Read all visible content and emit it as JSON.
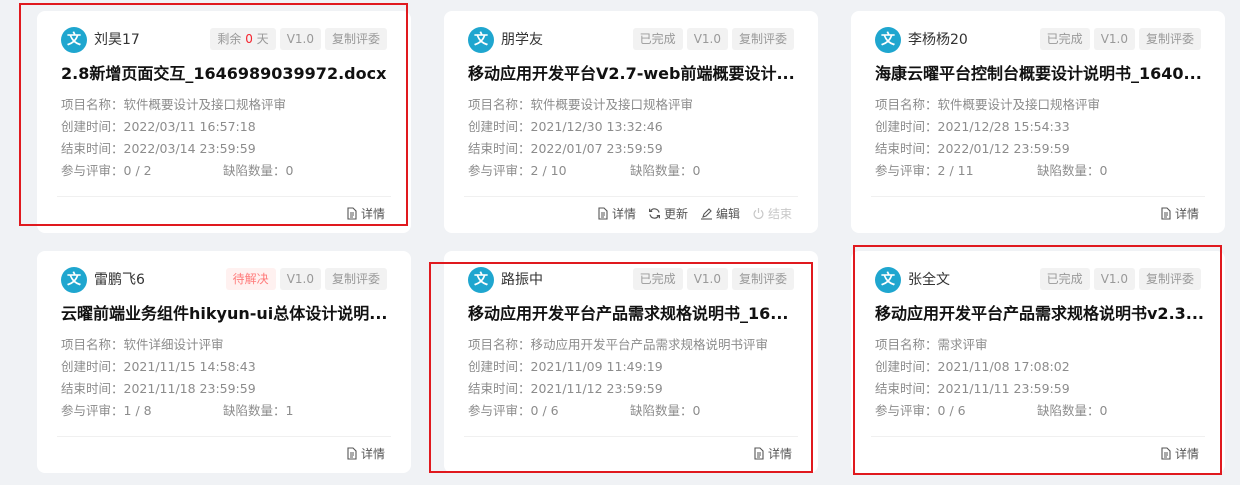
{
  "labels": {
    "project": "项目名称：",
    "created": "创建时间：",
    "ended": "结束时间：",
    "participants": "参与评审：",
    "defects": "缺陷数量：",
    "detail": "详情",
    "update": "更新",
    "edit": "编辑",
    "finish": "结束",
    "version": "V1.0",
    "copy_reviewers": "复制评委",
    "remaining_prefix": "剩余",
    "remaining_suffix": "天"
  },
  "cards": [
    {
      "avatar": "文",
      "user": "刘昊17",
      "status": "",
      "remaining_days": "0",
      "title": "2.8新增页面交互_1646989039972.docx",
      "project": "软件概要设计及接口规格评审",
      "created": "2022/03/11 16:57:18",
      "ended": "2022/03/14 23:59:59",
      "participants": "0 / 2",
      "defects": "0"
    },
    {
      "avatar": "文",
      "user": "朋学友",
      "status": "已完成",
      "title": "移动应用开发平台V2.7-web前端概要设计...",
      "project": "软件概要设计及接口规格评审",
      "created": "2021/12/30 13:32:46",
      "ended": "2022/01/07 23:59:59",
      "participants": "2 / 10",
      "defects": "0"
    },
    {
      "avatar": "文",
      "user": "李杨杨20",
      "status": "已完成",
      "title": "海康云曜平台控制台概要设计说明书_1640...",
      "project": "软件概要设计及接口规格评审",
      "created": "2021/12/28 15:54:33",
      "ended": "2022/01/12 23:59:59",
      "participants": "2 / 11",
      "defects": "0"
    },
    {
      "avatar": "文",
      "user": "雷鹏飞6",
      "status": "待解决",
      "title": "云曜前端业务组件hikyun-ui总体设计说明...",
      "project": "软件详细设计评审",
      "created": "2021/11/15 14:58:43",
      "ended": "2021/11/18 23:59:59",
      "participants": "1 / 8",
      "defects": "1"
    },
    {
      "avatar": "文",
      "user": "路振中",
      "status": "已完成",
      "title": "移动应用开发平台产品需求规格说明书_16...",
      "project": "移动应用开发平台产品需求规格说明书评审",
      "created": "2021/11/09 11:49:19",
      "ended": "2021/11/12 23:59:59",
      "participants": "0 / 6",
      "defects": "0"
    },
    {
      "avatar": "文",
      "user": "张全文",
      "status": "已完成",
      "title": "移动应用开发平台产品需求规格说明书v2.3...",
      "project": "需求评审",
      "created": "2021/11/08 17:08:02",
      "ended": "2021/11/11 23:59:59",
      "participants": "0 / 6",
      "defects": "0"
    }
  ],
  "colors": {
    "avatar": "#1fa6cf",
    "highlight_border": "#e0191e",
    "remaining_zero": "#f5222d",
    "pending_status": "#ff7a7a"
  },
  "icons": {
    "detail": "document-icon",
    "update": "refresh-icon",
    "edit": "pencil-icon",
    "finish": "power-icon"
  }
}
